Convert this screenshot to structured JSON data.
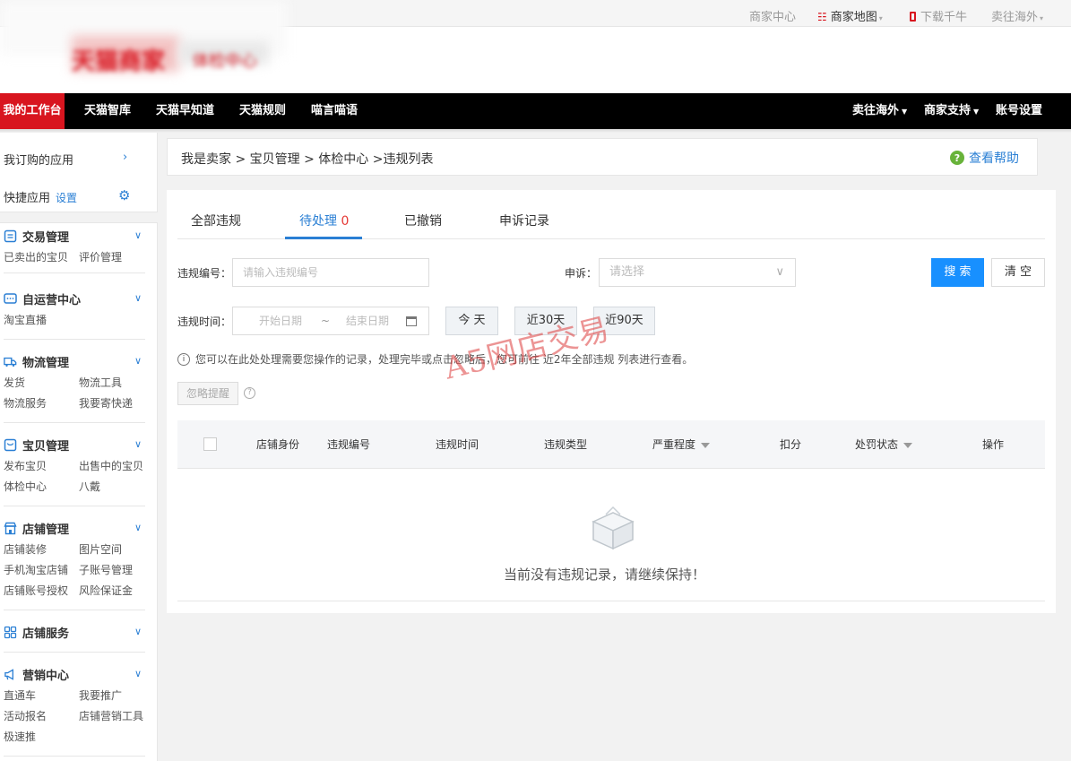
{
  "topbar": {
    "links": [
      {
        "label": "商家中心"
      },
      {
        "label": "商家地图"
      },
      {
        "label": "下载千牛"
      },
      {
        "label": "卖往海外"
      }
    ]
  },
  "header": {
    "logo_text": "天猫商家",
    "logo_sub": "体检中心"
  },
  "nav": {
    "left": [
      "我的工作台",
      "天猫智库",
      "天猫早知道",
      "天猫规则",
      "喵言喵语"
    ],
    "right": [
      "卖往海外",
      "商家支持",
      "账号设置"
    ]
  },
  "sidebar": {
    "my_apps": "我订购的应用",
    "quick_apps": "快捷应用",
    "quick_setting": "设置",
    "sections": [
      {
        "title": "交易管理",
        "icon": "order-icon",
        "items": [
          "已卖出的宝贝",
          "评价管理"
        ]
      },
      {
        "title": "自运营中心",
        "icon": "chat-icon",
        "items": [
          "淘宝直播"
        ]
      },
      {
        "title": "物流管理",
        "icon": "truck-icon",
        "items": [
          "发货",
          "物流工具",
          "物流服务",
          "我要寄快递"
        ]
      },
      {
        "title": "宝贝管理",
        "icon": "goods-icon",
        "items": [
          "发布宝贝",
          "出售中的宝贝",
          "体检中心",
          "八戴"
        ]
      },
      {
        "title": "店铺管理",
        "icon": "store-icon",
        "items": [
          "店铺装修",
          "图片空间",
          "手机淘宝店铺",
          "子账号管理",
          "店铺账号授权",
          "风险保证金"
        ]
      },
      {
        "title": "店铺服务",
        "icon": "grid-icon",
        "items": []
      },
      {
        "title": "营销中心",
        "icon": "megaphone-icon",
        "items": [
          "直通车",
          "我要推广",
          "活动报名",
          "店铺营销工具",
          "极速推"
        ]
      }
    ]
  },
  "breadcrumb": {
    "text": "我是卖家 > 宝贝管理 > 体检中心 >违规列表",
    "help": "查看帮助"
  },
  "tabs": [
    {
      "label": "全部违规"
    },
    {
      "label": "待处理",
      "count": "0"
    },
    {
      "label": "已撤销"
    },
    {
      "label": "申诉记录"
    }
  ],
  "filters": {
    "violation_no_label": "违规编号：",
    "violation_no_placeholder": "请输入违规编号",
    "appeal_label": "申诉：",
    "appeal_placeholder": "请选择",
    "search_button": "搜 索",
    "clear_button": "清 空",
    "time_label": "违规时间：",
    "start_placeholder": "开始日期",
    "range_sep": "~",
    "end_placeholder": "结束日期",
    "today": "今 天",
    "last30": "近30天",
    "last90": "近90天"
  },
  "info_text": "您可以在此处处理需要您操作的记录，处理完毕或点击忽略后，您可前往 近2年全部违规 列表进行查看。",
  "ignore_button": "忽略提醒",
  "table": {
    "columns": [
      "店铺身份",
      "违规编号",
      "违规时间",
      "违规类型",
      "严重程度",
      "扣分",
      "处罚状态",
      "操作"
    ],
    "empty_text": "当前没有违规记录，请继续保持！"
  },
  "watermark": "A5网店交易",
  "colors": {
    "accent": "#1890ff",
    "nav_active": "#d8151f",
    "nav_bg": "#000000",
    "count": "#e53935"
  }
}
